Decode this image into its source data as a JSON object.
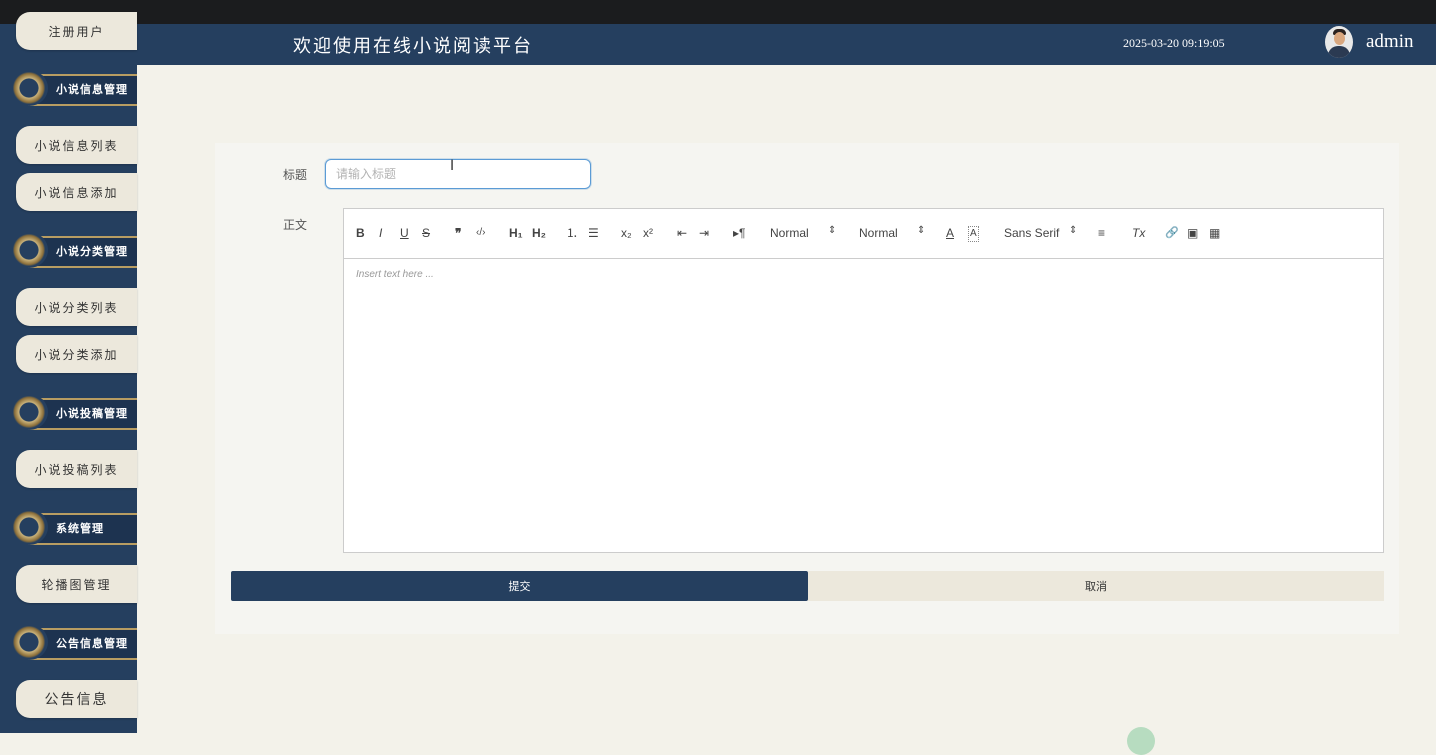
{
  "header": {
    "title": "欢迎使用在线小说阅读平台",
    "datetime": "2025-03-20 09:19:05",
    "user": "admin"
  },
  "sidebar": {
    "items": [
      {
        "type": "item",
        "label": "注册用户"
      },
      {
        "type": "group",
        "label": "小说信息管理"
      },
      {
        "type": "item",
        "label": "小说信息列表"
      },
      {
        "type": "item",
        "label": "小说信息添加"
      },
      {
        "type": "group",
        "label": "小说分类管理"
      },
      {
        "type": "item",
        "label": "小说分类列表"
      },
      {
        "type": "item",
        "label": "小说分类添加"
      },
      {
        "type": "group",
        "label": "小说投稿管理"
      },
      {
        "type": "item",
        "label": "小说投稿列表"
      },
      {
        "type": "group",
        "label": "系统管理"
      },
      {
        "type": "item",
        "label": "轮播图管理"
      },
      {
        "type": "group",
        "label": "公告信息管理"
      },
      {
        "type": "item",
        "label": "公告信息"
      }
    ]
  },
  "form": {
    "title_label": "标题",
    "title_placeholder": "请输入标题",
    "title_value": "",
    "body_label": "正文",
    "editor": {
      "toolbar": {
        "bold": "B",
        "italic": "I",
        "underline": "U",
        "strike": "S",
        "blockquote": "❞",
        "code": "‹/›",
        "h1": "H₁",
        "h2": "H₂",
        "ordered_list": "⒈",
        "bullet_list": "☰",
        "subscript": "x₂",
        "superscript": "x²",
        "outdent": "⇤",
        "indent": "⇥",
        "direction": "▸¶",
        "size_select": "Normal",
        "header_select": "Normal",
        "font_color": "A",
        "background": "A",
        "font_select": "Sans Serif",
        "align": "≡",
        "clean": "Tx",
        "link": "🔗",
        "image": "▣",
        "video": "▦"
      },
      "placeholder": "Insert text here ..."
    },
    "submit_label": "提交",
    "cancel_label": "取消"
  },
  "colors": {
    "navy": "#253f5f",
    "beige": "#ece8dc",
    "page_bg": "#f3f2ea",
    "gold": "#b89d62"
  }
}
